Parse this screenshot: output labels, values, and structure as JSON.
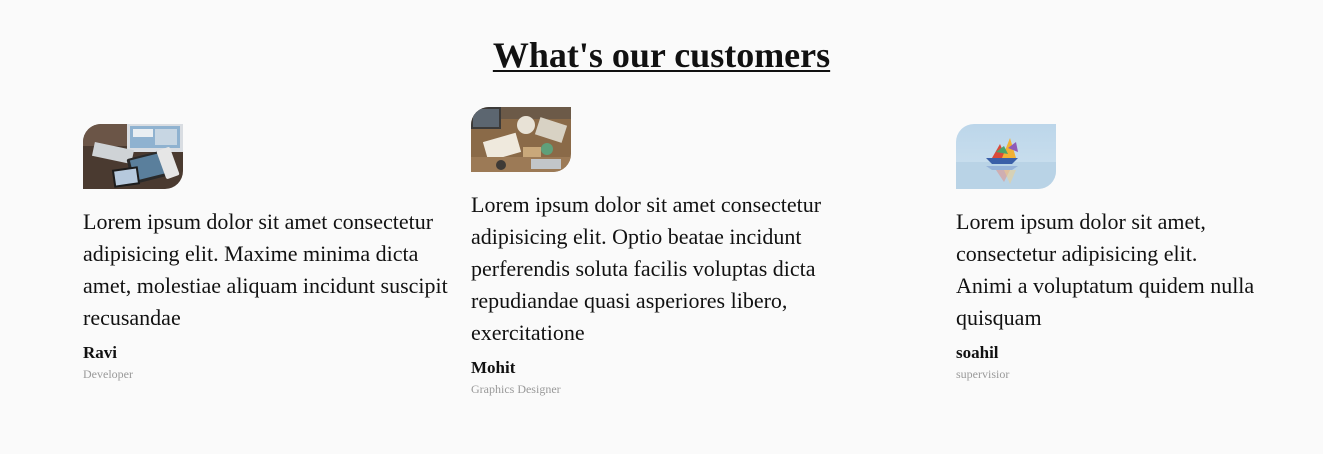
{
  "section": {
    "title": "What's our customers"
  },
  "testimonials": [
    {
      "image_icon": "workspace-devices-photo",
      "quote": "Lorem ipsum dolor sit amet consectetur adipisicing elit. Maxime minima dicta amet, molestiae aliquam incidunt suscipit recusandae",
      "name": "Ravi",
      "role": "Developer"
    },
    {
      "image_icon": "desk-topdown-photo",
      "quote": "Lorem ipsum dolor sit amet consectetur adipisicing elit. Optio beatae incidunt perferendis soluta facilis voluptas dicta repudiandae quasi asperiores libero, exercitatione",
      "name": "Mohit",
      "role": "Graphics Designer"
    },
    {
      "image_icon": "paper-boat-photo",
      "quote": "Lorem ipsum dolor sit amet, consectetur adipisicing elit. Animi a voluptatum quidem nulla quisquam",
      "name": "soahil",
      "role": "supervisior"
    }
  ]
}
